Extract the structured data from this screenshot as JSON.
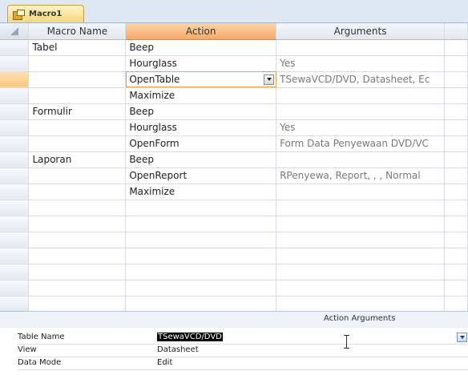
{
  "tab": {
    "title": "Macro1"
  },
  "grid": {
    "headers": {
      "macro_name": "Macro Name",
      "action": "Action",
      "arguments": "Arguments"
    },
    "rows": [
      {
        "macro_name": "Tabel",
        "action": "Beep",
        "arguments": ""
      },
      {
        "macro_name": "",
        "action": "Hourglass",
        "arguments": "Yes"
      },
      {
        "macro_name": "",
        "action": "OpenTable",
        "arguments": "TSewaVCD/DVD, Datasheet, Ec"
      },
      {
        "macro_name": "",
        "action": "Maximize",
        "arguments": ""
      },
      {
        "macro_name": "Formulir",
        "action": "Beep",
        "arguments": ""
      },
      {
        "macro_name": "",
        "action": "Hourglass",
        "arguments": "Yes"
      },
      {
        "macro_name": "",
        "action": "OpenForm",
        "arguments": "Form Data Penyewaan DVD/VC"
      },
      {
        "macro_name": "Laporan",
        "action": "Beep",
        "arguments": ""
      },
      {
        "macro_name": "",
        "action": "OpenReport",
        "arguments": "RPenyewa, Report, , , Normal"
      },
      {
        "macro_name": "",
        "action": "Maximize",
        "arguments": ""
      },
      {
        "macro_name": "",
        "action": "",
        "arguments": ""
      },
      {
        "macro_name": "",
        "action": "",
        "arguments": ""
      },
      {
        "macro_name": "",
        "action": "",
        "arguments": ""
      },
      {
        "macro_name": "",
        "action": "",
        "arguments": ""
      },
      {
        "macro_name": "",
        "action": "",
        "arguments": ""
      },
      {
        "macro_name": "",
        "action": "",
        "arguments": ""
      },
      {
        "macro_name": "",
        "action": "",
        "arguments": ""
      }
    ],
    "current_row": 2
  },
  "action_arguments": {
    "title": "Action Arguments",
    "properties": [
      {
        "label": "Table Name",
        "value": "TSewaVCD/DVD"
      },
      {
        "label": "View",
        "value": "Datasheet"
      },
      {
        "label": "Data Mode",
        "value": "Edit"
      }
    ]
  },
  "colors": {
    "accent": "#f6a965",
    "tab": "#f6d77d",
    "selected_row": "#f8c77d"
  }
}
